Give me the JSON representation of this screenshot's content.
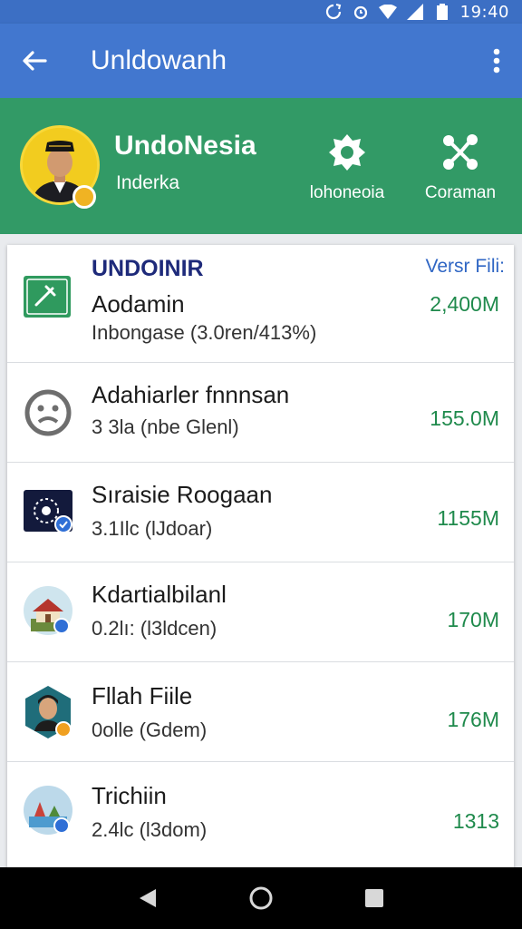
{
  "status_bar": {
    "time": "19:40"
  },
  "app_bar": {
    "title": "Unldowanh"
  },
  "profile": {
    "name": "UndoNesia",
    "subtitle": "Inderka",
    "actions": [
      {
        "label": "lohoneoia",
        "icon": "settings-icon"
      },
      {
        "label": "Coraman",
        "icon": "share-icon"
      }
    ]
  },
  "card": {
    "heading": "UNDOINIR",
    "link": "Versr Fili:",
    "items": [
      {
        "title": "Aodamin",
        "subtitle": "Inbongase (3.0ren/413%)",
        "size": "2,400M",
        "icon": "app-install-icon"
      },
      {
        "title": "Adahiarler fnnnsan",
        "subtitle": "3 3la (nbe Glenl)",
        "size": "155.0M",
        "icon": "sad-face-icon"
      },
      {
        "title": "Sıraisie Roogaan",
        "subtitle": "3.1Ilc (lJdoar)",
        "size": "1155M",
        "icon": "dots-app-icon"
      },
      {
        "title": "Kdartialbilanl",
        "subtitle": "0.2lı: (l3ldcen)",
        "size": "170M",
        "icon": "house-app-icon"
      },
      {
        "title": "Fllah Fiile",
        "subtitle": "0olle (Gdem)",
        "size": "176M",
        "icon": "portrait-app-icon"
      },
      {
        "title": "Trichiin",
        "subtitle": "2.4lc (l3dom)",
        "size": "1313",
        "icon": "scene-app-icon"
      }
    ]
  },
  "colors": {
    "app_bar": "#4277cf",
    "profile_bg": "#329a66",
    "accent_green": "#1f8a4c",
    "link_blue": "#2f66c4"
  }
}
